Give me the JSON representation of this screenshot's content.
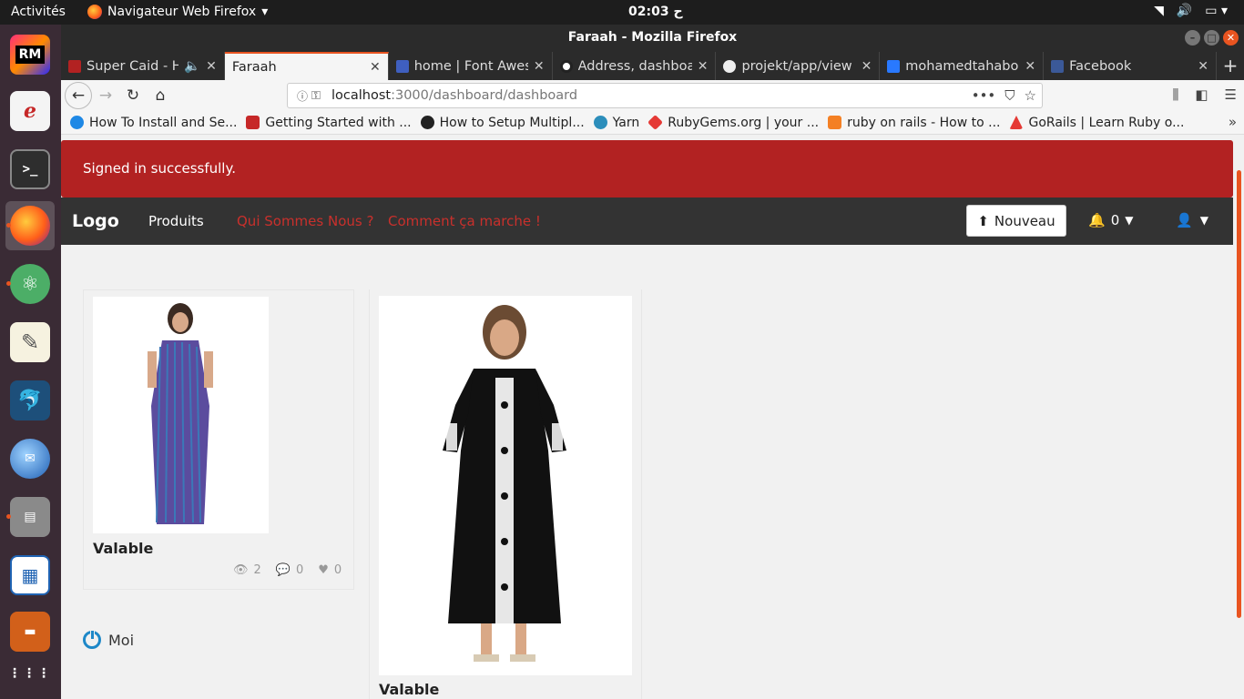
{
  "topbar": {
    "activities": "Activités",
    "app_menu": "Navigateur Web Firefox",
    "clock": "ح 02:03"
  },
  "window": {
    "title": "Faraah - Mozilla Firefox"
  },
  "tabs": [
    {
      "label": "Super Caid - Ho",
      "color": "#b22222"
    },
    {
      "label": "Faraah",
      "color": ""
    },
    {
      "label": "home | Font Awes",
      "color": "#3f5fbf"
    },
    {
      "label": "Address, dashboa",
      "color": "#222222"
    },
    {
      "label": "projekt/app/view",
      "color": "#222222"
    },
    {
      "label": "mohamedtahabou",
      "color": "#2979ff"
    },
    {
      "label": "Facebook",
      "color": "#3b5998"
    }
  ],
  "url": {
    "host": "localhost",
    "path": ":3000/dashboard/dashboard"
  },
  "bookmarks": [
    {
      "label": "How To Install and Se...",
      "color": "#1e88e5"
    },
    {
      "label": "Getting Started with ...",
      "color": "#c62828"
    },
    {
      "label": "How to Setup Multipl...",
      "color": "#222222"
    },
    {
      "label": "Yarn",
      "color": "#2c8ebb"
    },
    {
      "label": "RubyGems.org | your ...",
      "color": "#e53935"
    },
    {
      "label": "ruby on rails - How to ...",
      "color": "#f48024"
    },
    {
      "label": "GoRails | Learn Ruby o...",
      "color": "#e53935"
    }
  ],
  "flash": "Signed in successfully.",
  "nav": {
    "logo": "Logo",
    "produits": "Produits",
    "qui": "Qui Sommes Nous ?",
    "comment": "Comment ça marche !",
    "nouveau": "Nouveau",
    "notif_count": "0"
  },
  "products": [
    {
      "title": "Valable",
      "views": "2",
      "comments": "0",
      "likes": "0"
    },
    {
      "title": "Valable"
    }
  ],
  "owner": "Moi",
  "colors": {
    "flash_bg": "#b22222",
    "navbar_bg": "#333333",
    "link_red": "#c9302c",
    "accent": "#e95420"
  }
}
